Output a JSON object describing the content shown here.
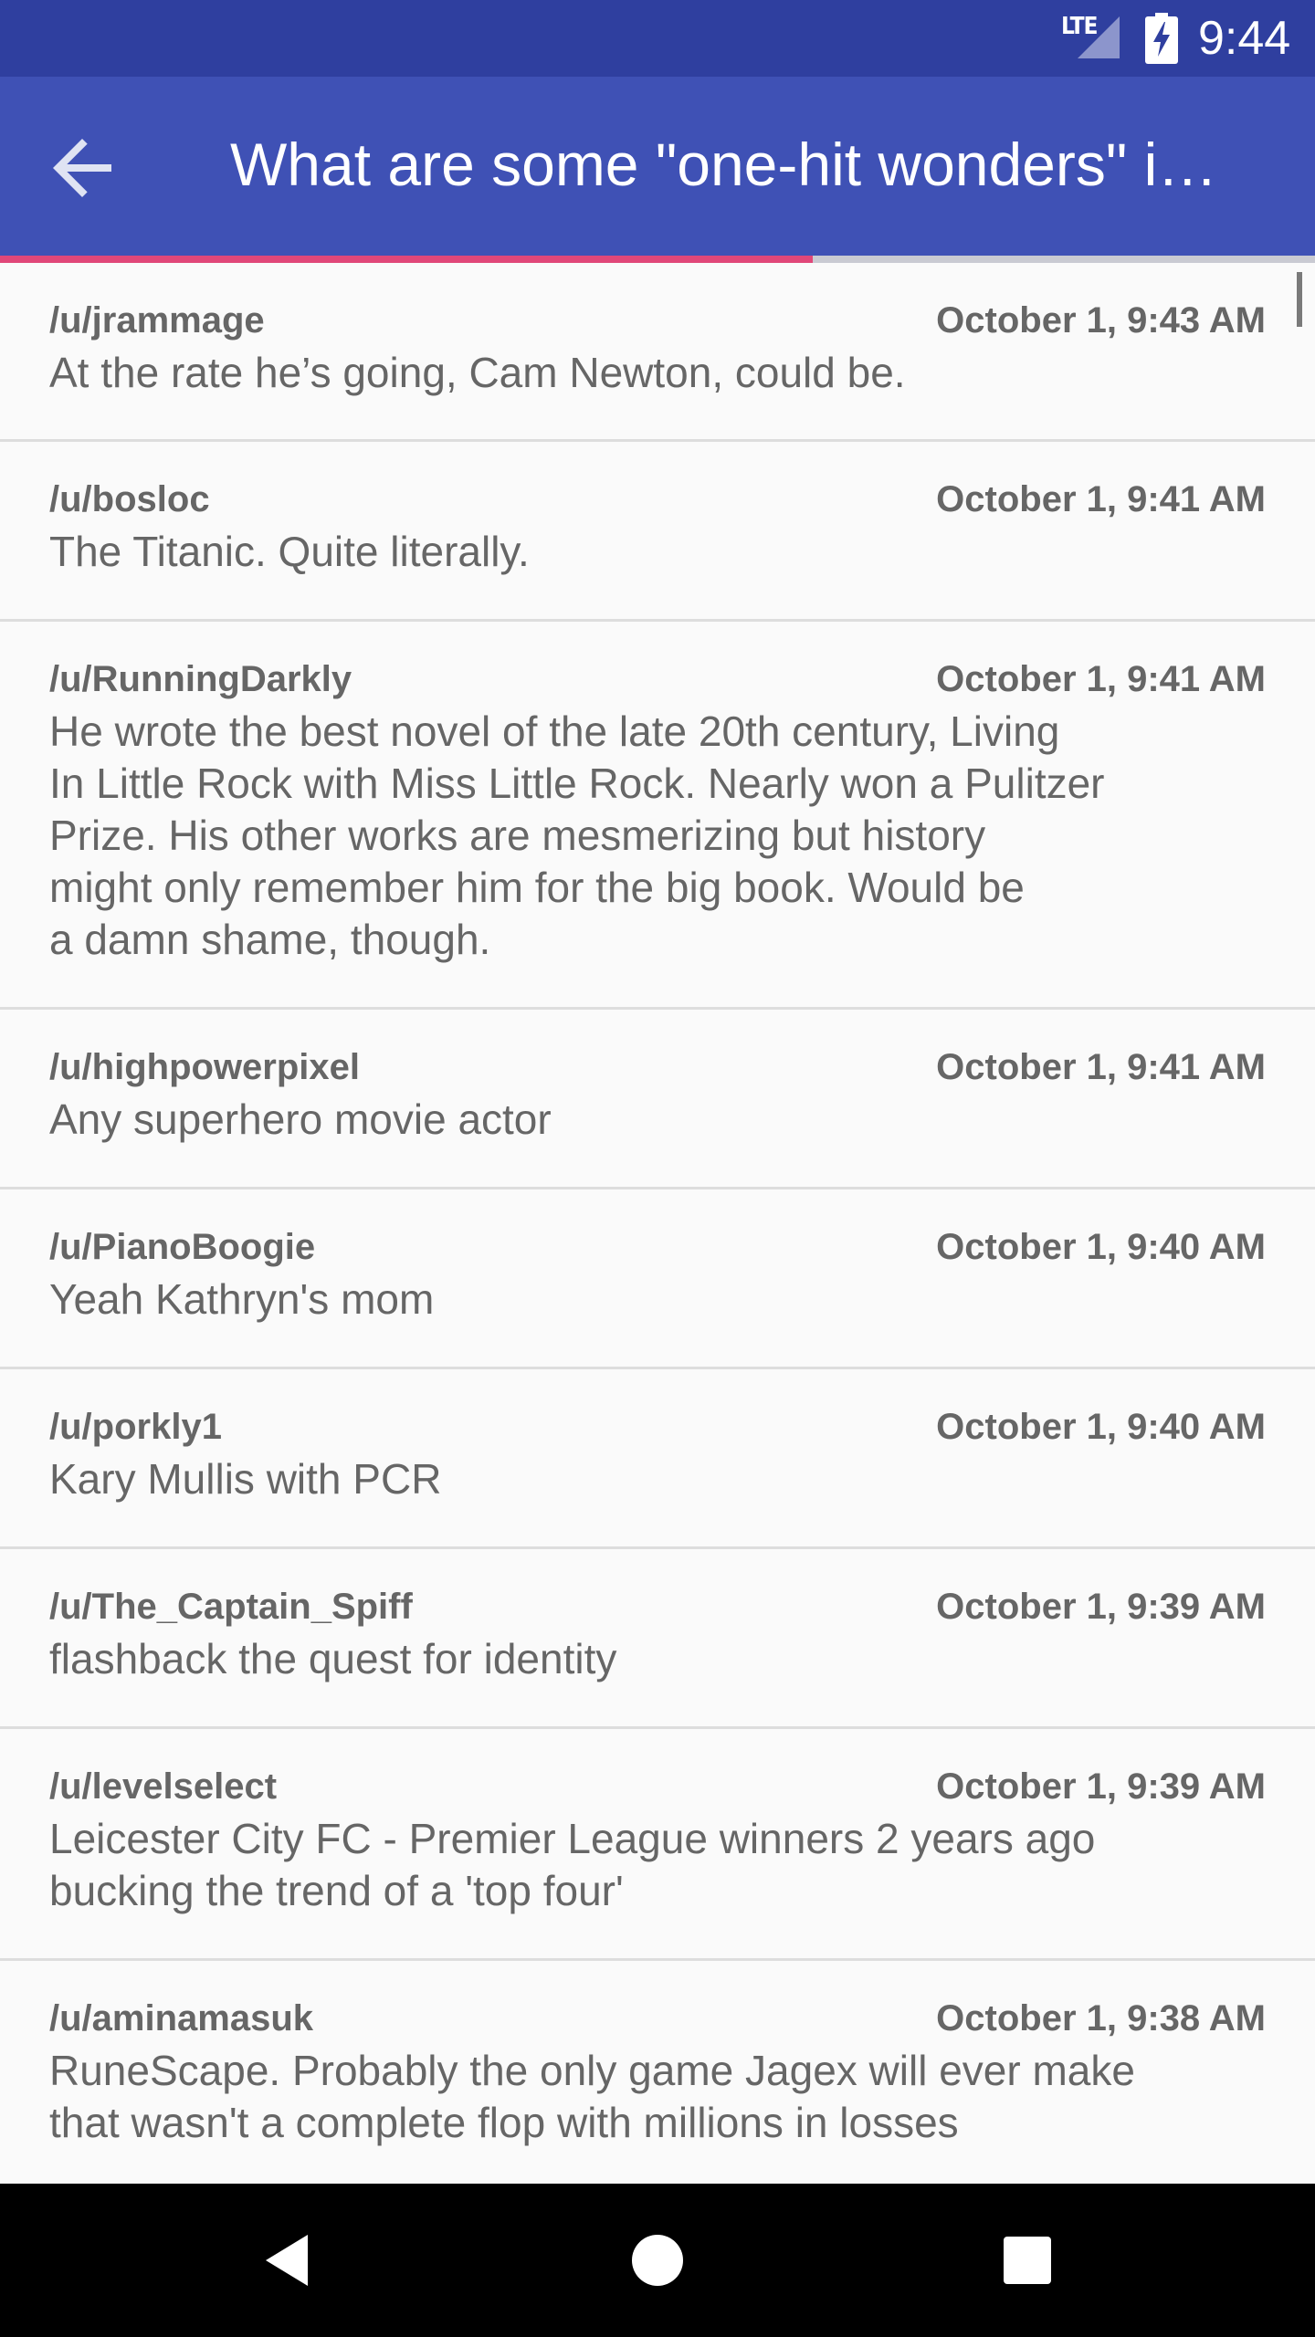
{
  "status_bar": {
    "network": "LTE",
    "time": "9:44"
  },
  "app_bar": {
    "title": "What are some \"one-hit wonders\" i…",
    "back_icon": "arrow-back-icon"
  },
  "progress": {
    "fraction": 0.618,
    "color": "#e04779"
  },
  "comments": [
    {
      "author": "/u/jrammage",
      "time": "October 1, 9:43 AM",
      "body": "At the rate he’s going, Cam Newton, could be."
    },
    {
      "author": "/u/bosloc",
      "time": "October 1, 9:41 AM",
      "body": "The Titanic. Quite literally."
    },
    {
      "author": "/u/RunningDarkly",
      "time": "October 1, 9:41 AM",
      "body": "He wrote the best novel of the late 20th century, Living\nIn Little Rock with Miss Little Rock. Nearly won a Pulitzer\nPrize. His other works are mesmerizing but history\nmight only remember him for the big book. Would be\na damn shame, though."
    },
    {
      "author": "/u/highpowerpixel",
      "time": "October 1, 9:41 AM",
      "body": "Any superhero movie actor"
    },
    {
      "author": "/u/PianoBoogie",
      "time": "October 1, 9:40 AM",
      "body": "Yeah Kathryn's mom"
    },
    {
      "author": "/u/porkly1",
      "time": "October 1, 9:40 AM",
      "body": "Kary Mullis with PCR"
    },
    {
      "author": "/u/The_Captain_Spiff",
      "time": "October 1, 9:39 AM",
      "body": "flashback the quest for identity"
    },
    {
      "author": "/u/levelselect",
      "time": "October 1, 9:39 AM",
      "body": "Leicester City FC - Premier League winners 2 years ago\nbucking the trend of a 'top four'"
    },
    {
      "author": "/u/aminamasuk",
      "time": "October 1, 9:38 AM",
      "body": "RuneScape. Probably the only game Jagex will ever make\nthat wasn't a complete flop with millions in losses"
    }
  ],
  "nav_bar": {
    "back_icon": "nav-back-icon",
    "home_icon": "nav-home-icon",
    "recents_icon": "nav-recents-icon"
  },
  "colors": {
    "status_bar": "#2f3f9f",
    "app_bar": "#3f51b5",
    "list_background": "#fafafa",
    "text": "#666666"
  }
}
